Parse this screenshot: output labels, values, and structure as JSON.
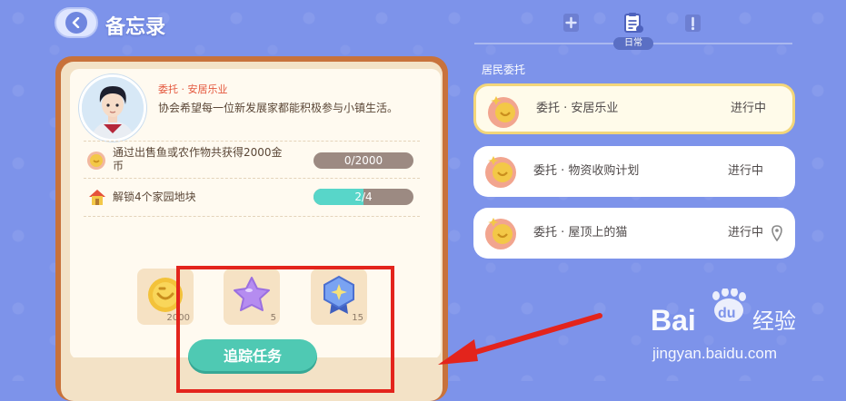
{
  "header": {
    "title": "备忘录",
    "active_tab_label": "日常"
  },
  "quest_detail": {
    "name": "委托 · 安居乐业",
    "description": "协会希望每一位新发展家都能积极参与小镇生活。",
    "tasks": [
      {
        "text_line1": "通过出售鱼或农作物共获得2000金",
        "text_line2": "币",
        "progress_label": "0/2000",
        "progress_fraction": 0.0,
        "icon": "coin-icon"
      },
      {
        "text_line1": "解锁4个家园地块",
        "text_line2": "",
        "progress_label": "2/4",
        "progress_fraction": 0.5,
        "icon": "house-icon"
      }
    ],
    "rewards": [
      {
        "icon": "gold-coin-icon",
        "qty": "2000"
      },
      {
        "icon": "purple-star-icon",
        "qty": "5"
      },
      {
        "icon": "blue-badge-icon",
        "qty": "15"
      }
    ],
    "track_button": "追踪任务"
  },
  "quest_list": {
    "section_label": "居民委托",
    "items": [
      {
        "name": "委托 · 安居乐业",
        "status": "进行中",
        "selected": true
      },
      {
        "name": "委托 · 物资收购计划",
        "status": "进行中",
        "selected": false
      },
      {
        "name": "委托 · 屋顶上的猫",
        "status": "进行中",
        "selected": false
      }
    ]
  },
  "watermark": {
    "logo_text": "Bai",
    "logo_text2": "du",
    "jingyan": "经验",
    "url": "jingyan.baidu.com"
  },
  "colors": {
    "background": "#7d93ea",
    "card_frame": "#c8723b",
    "accent_red": "#e3241c",
    "teal": "#4fc9b3"
  }
}
